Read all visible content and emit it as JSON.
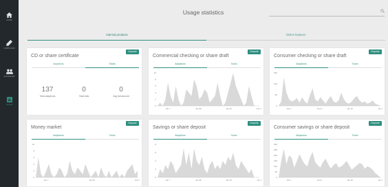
{
  "sidebar": {
    "items": [
      {
        "label": "Home",
        "icon": "home-icon"
      },
      {
        "label": "Campaigns",
        "icon": "megaphone-icon"
      },
      {
        "label": "Audiences",
        "icon": "people-icon"
      },
      {
        "label": "Usage",
        "icon": "chart-icon"
      }
    ],
    "active_color": "#2f8f7f"
  },
  "header": {
    "title": "Usage statistics",
    "search_placeholder": ""
  },
  "tabs": [
    {
      "label": "Internal products"
    },
    {
      "label": "Online features"
    }
  ],
  "cards": [
    {
      "title": "CD or share certificate",
      "badge": "Deposit",
      "tab_adoptions": "Adoptions",
      "tab_totals": "Totals",
      "stats": [
        {
          "value": "137",
          "caption": "Total adoptions"
        },
        {
          "value": "0",
          "caption": "Total bals"
        },
        {
          "value": "0",
          "caption": "Avg bal amount"
        }
      ]
    },
    {
      "title": "Commercial checking or share draft",
      "badge": "Deposit",
      "tab_adoptions": "Adoptions",
      "tab_totals": "Totals",
      "chart_data": {
        "type": "area",
        "yticks": [
          "10",
          "8",
          "6",
          "4",
          "2",
          "0"
        ],
        "xticks": [
          "Jan 7",
          "Jan 08",
          "Jan 15",
          "Jan 12"
        ],
        "ylim": [
          0,
          10
        ],
        "values": [
          0,
          1,
          0,
          2,
          7,
          3,
          1,
          6,
          2,
          0,
          1,
          5,
          4,
          3,
          8,
          6,
          2,
          3,
          5,
          4,
          1,
          2,
          3,
          7,
          3,
          0,
          1,
          4,
          7,
          10,
          6,
          4,
          2,
          0,
          1,
          6,
          3,
          0,
          0,
          0
        ]
      }
    },
    {
      "title": "Consumer checking or share draft",
      "badge": "Deposit",
      "tab_adoptions": "Adoptions",
      "tab_totals": "Totals",
      "chart_data": {
        "type": "area",
        "yticks": [
          "150",
          "100",
          "50",
          "0"
        ],
        "xticks": [
          "Jan 1",
          "Jan 8",
          "Jan 15",
          "Jan 1"
        ],
        "ylim": [
          0,
          150
        ],
        "values": [
          0,
          20,
          130,
          60,
          30,
          20,
          25,
          35,
          15,
          40,
          20,
          10,
          50,
          80,
          30,
          20,
          40,
          25,
          10,
          30,
          45,
          20,
          15,
          25,
          60,
          30,
          15,
          10,
          20,
          35,
          45,
          25,
          15,
          20,
          10,
          15,
          25,
          10,
          5,
          0
        ]
      }
    },
    {
      "title": "Money market",
      "badge": "Deposit",
      "tab_adoptions": "Adoptions",
      "tab_totals": "Totals",
      "chart_data": {
        "type": "area",
        "yticks": [
          "10",
          "8",
          "6",
          "4",
          "2",
          "0"
        ],
        "xticks": [
          "Jan 7",
          "Jan 08",
          "Jan 15"
        ],
        "ylim": [
          0,
          10
        ],
        "values": [
          0,
          6,
          1,
          0,
          2,
          4,
          1,
          0,
          1,
          3,
          2,
          0,
          1,
          5,
          2,
          1,
          3,
          2,
          1,
          4,
          2,
          0,
          1,
          2,
          0,
          3,
          1,
          0,
          2,
          0,
          1,
          2,
          0,
          1,
          0,
          2,
          3,
          4,
          1,
          2
        ]
      }
    },
    {
      "title": "Savings or share deposit",
      "badge": "Deposit",
      "tab_adoptions": "Adoptions",
      "tab_totals": "Totals",
      "chart_data": {
        "type": "area",
        "yticks": [
          "8",
          "6",
          "4",
          "2",
          "0"
        ],
        "xticks": [
          "Jan 7",
          "Jan 08",
          "Jan 15",
          "Jan 1"
        ],
        "ylim": [
          0,
          8
        ],
        "values": [
          0,
          2,
          1,
          3,
          2,
          4,
          3,
          1,
          2,
          3,
          7,
          3,
          6,
          2,
          7,
          4,
          3,
          5,
          2,
          1,
          3,
          4,
          2,
          3,
          2,
          4,
          3,
          5,
          4,
          6,
          3,
          2,
          4,
          3,
          2,
          1,
          2,
          0,
          0,
          0
        ]
      }
    },
    {
      "title": "Consumer savings or share deposit",
      "badge": "Deposit",
      "tab_adoptions": "Adoptions",
      "tab_totals": "Totals",
      "chart_data": {
        "type": "area",
        "yticks": [
          "300",
          "250",
          "200",
          "150",
          "100",
          "50",
          "0"
        ],
        "xticks": [
          "Jan 1",
          "Jan 8",
          "Jan 15",
          "Jan 1"
        ],
        "ylim": [
          0,
          300
        ],
        "values": [
          0,
          150,
          260,
          120,
          200,
          180,
          90,
          150,
          210,
          160,
          120,
          100,
          180,
          230,
          140,
          110,
          90,
          140,
          170,
          120,
          80,
          110,
          130,
          90,
          100,
          120,
          150,
          110,
          70,
          90,
          110,
          130,
          120,
          80,
          100,
          90,
          70,
          40,
          20,
          0
        ]
      }
    }
  ]
}
